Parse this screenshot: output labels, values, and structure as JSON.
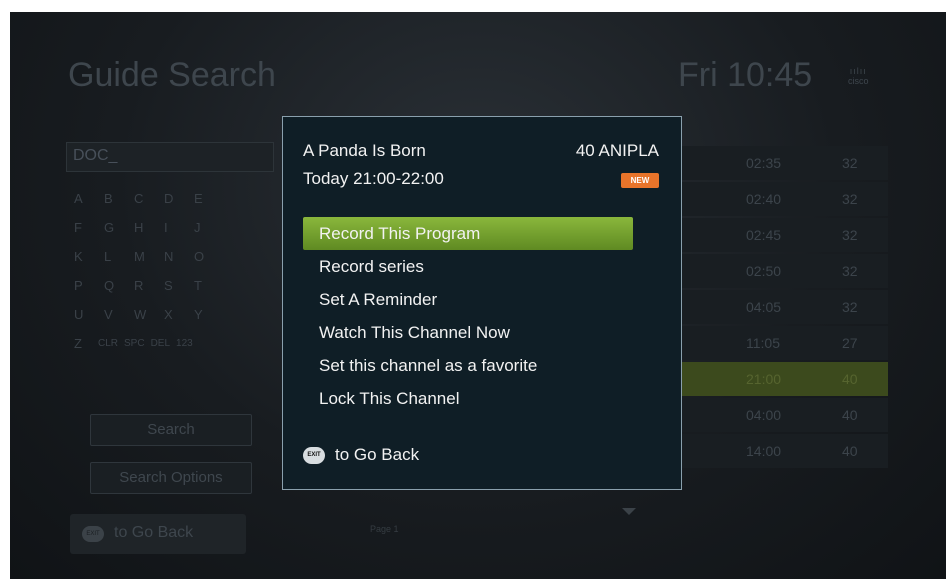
{
  "header": {
    "title": "Guide Search",
    "clock": "Fri 10:45",
    "brand": "cisco"
  },
  "search": {
    "query": "DOC_",
    "keyboard_rows": [
      [
        "A",
        "B",
        "C",
        "D",
        "E"
      ],
      [
        "F",
        "G",
        "H",
        "I",
        "J"
      ],
      [
        "K",
        "L",
        "M",
        "N",
        "O"
      ],
      [
        "P",
        "Q",
        "R",
        "S",
        "T"
      ],
      [
        "U",
        "V",
        "W",
        "X",
        "Y"
      ],
      [
        "Z",
        "CLR",
        "SPC",
        "DEL",
        "123"
      ]
    ],
    "search_label": "Search",
    "options_label": "Search Options",
    "exit_icon_text": "EXIT",
    "back_label": "to Go Back",
    "page_label": "Page 1"
  },
  "results": [
    {
      "time": "02:35",
      "channel": "32"
    },
    {
      "time": "02:40",
      "channel": "32"
    },
    {
      "time": "02:45",
      "channel": "32"
    },
    {
      "time": "02:50",
      "channel": "32"
    },
    {
      "time": "04:05",
      "channel": "32"
    },
    {
      "time": "11:05",
      "channel": "27"
    },
    {
      "time": "21:00",
      "channel": "40"
    },
    {
      "time": "04:00",
      "channel": "40"
    },
    {
      "time": "14:00",
      "channel": "40"
    }
  ],
  "popup": {
    "title": "A Panda Is Born",
    "channel": "40 ANIPLA",
    "time": "Today 21:00-22:00",
    "badge": "NEW",
    "menu": [
      "Record This Program",
      "Record series",
      "Set A Reminder",
      "Watch This Channel Now",
      "Set this channel as a favorite",
      "Lock This Channel"
    ],
    "exit_icon_text": "EXIT",
    "back_label": "to Go Back"
  },
  "colors": {
    "accent": "#8ab73c",
    "badge": "#e8742a",
    "popup_bg": "#0f1e26"
  }
}
